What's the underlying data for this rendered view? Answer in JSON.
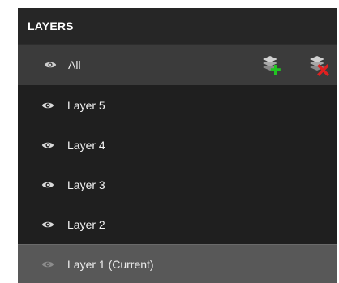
{
  "panel": {
    "title": "LAYERS"
  },
  "all_row": {
    "label": "All",
    "add_action": {
      "icon": "add-layer-icon"
    },
    "delete_action": {
      "icon": "delete-layer-icon"
    }
  },
  "layers": [
    {
      "label": "Layer 5",
      "icon": "eye-icon"
    },
    {
      "label": "Layer 4",
      "icon": "eye-icon"
    },
    {
      "label": "Layer 3",
      "icon": "eye-icon"
    },
    {
      "label": "Layer 2",
      "icon": "eye-icon"
    },
    {
      "label": "Layer 1 (Current)",
      "icon": "eye-icon",
      "current": true
    }
  ],
  "colors": {
    "panel_bg": "#1f1f1f",
    "header_bg": "#262626",
    "all_row_bg": "#3b3b3b",
    "current_row_bg": "#585858",
    "add_accent": "#22c422",
    "delete_accent": "#e02020"
  }
}
